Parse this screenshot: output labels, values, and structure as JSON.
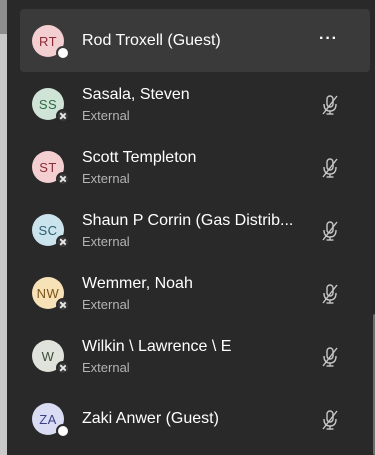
{
  "participants": [
    {
      "initials": "RT",
      "name": "Rod Troxell (Guest)",
      "subtitle": "",
      "avatar_bg": "#f4cfd2",
      "avatar_fg": "#8b2b35",
      "more_label": "···"
    },
    {
      "initials": "SS",
      "name": "Sasala, Steven",
      "subtitle": "External",
      "avatar_bg": "#cfe4d6",
      "avatar_fg": "#2e6a45"
    },
    {
      "initials": "ST",
      "name": "Scott Templeton",
      "subtitle": "External",
      "avatar_bg": "#f4cfd2",
      "avatar_fg": "#8b2b35"
    },
    {
      "initials": "SC",
      "name": "Shaun P Corrin (Gas Distrib...",
      "subtitle": "External",
      "avatar_bg": "#cbe3ec",
      "avatar_fg": "#2a5f72"
    },
    {
      "initials": "NW",
      "name": "Wemmer, Noah",
      "subtitle": "External",
      "avatar_bg": "#f7e1b7",
      "avatar_fg": "#7a5417"
    },
    {
      "initials": "W",
      "name": "Wilkin \\ Lawrence \\ E",
      "subtitle": "External",
      "avatar_bg": "#dfe3dc",
      "avatar_fg": "#3f4a3a"
    },
    {
      "initials": "ZA",
      "name": "Zaki Anwer (Guest)",
      "subtitle": "",
      "avatar_bg": "#d9dcf2",
      "avatar_fg": "#3b3f86"
    }
  ],
  "icons": {
    "mic": "mic-muted-icon",
    "more": "more-options-icon",
    "external": "external-badge-icon"
  }
}
